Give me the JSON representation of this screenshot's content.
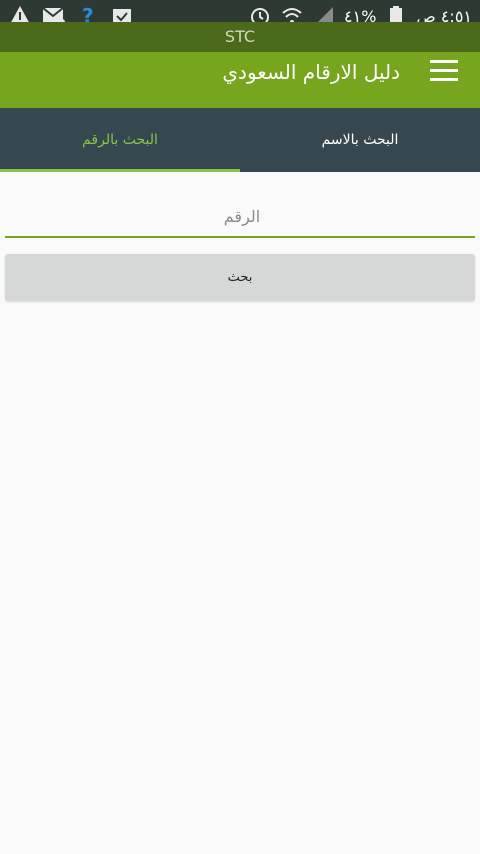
{
  "status_bar": {
    "time": "٤:٥١ ص",
    "battery": "٤١%",
    "icons_left": [
      "warning-icon",
      "mail-icon",
      "help-icon",
      "clipboard-check-icon"
    ],
    "icons_right": [
      "alarm-icon",
      "wifi-icon",
      "signal-icon",
      "battery-icon"
    ]
  },
  "carrier": "STC",
  "app_bar": {
    "title": "دليل الارقام السعودي",
    "menu_icon": "menu-icon"
  },
  "tabs": [
    {
      "label": "البحث بالاسم",
      "active": false
    },
    {
      "label": "البحث بالرقم",
      "active": true
    }
  ],
  "form": {
    "number_placeholder": "الرقم",
    "number_value": "",
    "search_label": "بحث"
  },
  "colors": {
    "app_bar": "#77a51d",
    "tab_bar": "#37474f",
    "accent": "#8bc34a",
    "button": "#d6d7d7"
  }
}
